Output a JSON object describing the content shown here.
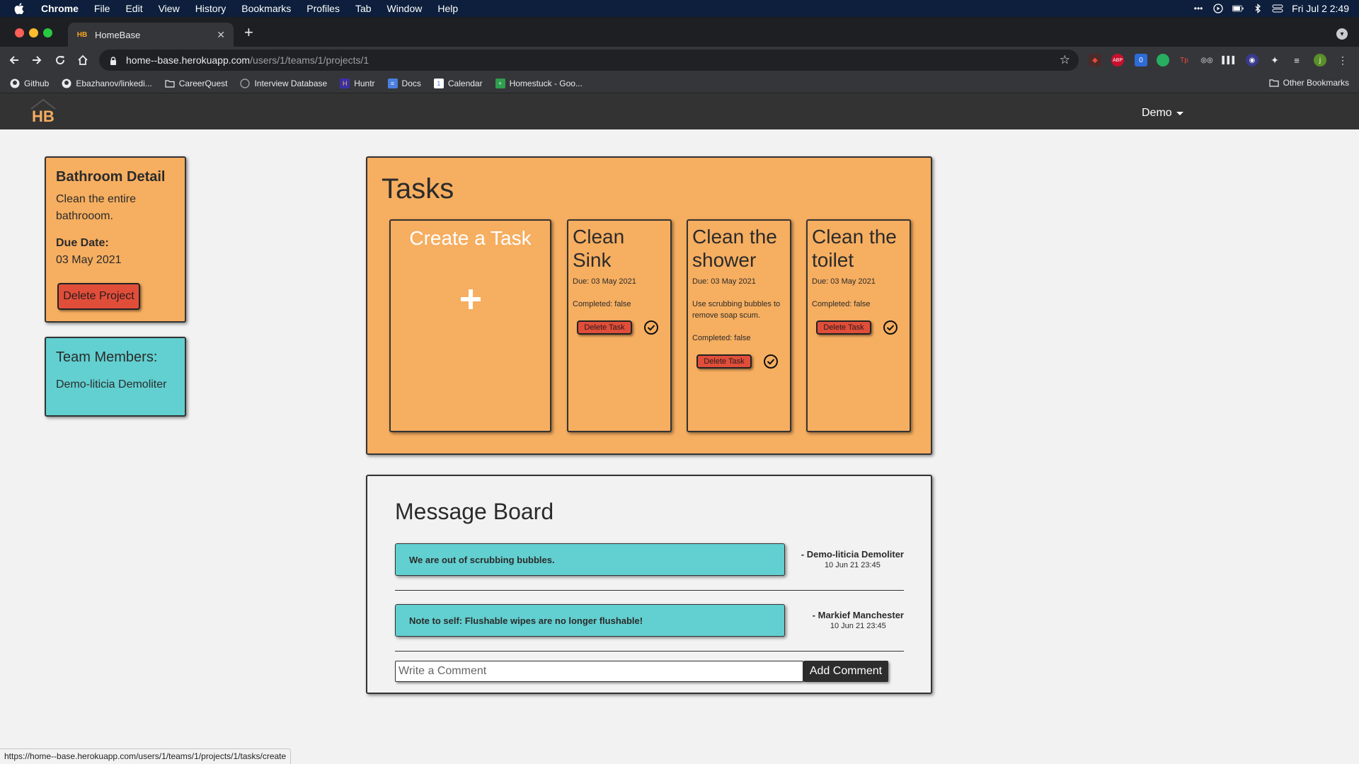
{
  "menubar": {
    "app": "Chrome",
    "items": [
      "File",
      "Edit",
      "View",
      "History",
      "Bookmarks",
      "Profiles",
      "Tab",
      "Window",
      "Help"
    ],
    "clock": "Fri Jul 2  2:49"
  },
  "browser": {
    "tab_title": "HomeBase",
    "url_host": "home--base.herokuapp.com",
    "url_path": "/users/1/teams/1/projects/1",
    "bookmarks": [
      "Github",
      "Ebazhanov/linkedi...",
      "CareerQuest",
      "Interview Database",
      "Huntr",
      "Docs",
      "Calendar",
      "Homestuck - Goo..."
    ],
    "other_bookmarks": "Other Bookmarks",
    "status_url": "https://home--base.herokuapp.com/users/1/teams/1/projects/1/tasks/create"
  },
  "app": {
    "logo_text": "HB",
    "user_menu": "Demo"
  },
  "project": {
    "title": "Bathroom Detail",
    "description": "Clean the entire bathrooom.",
    "due_label": "Due Date:",
    "due_value": "03 May 2021",
    "delete_label": "Delete Project"
  },
  "team": {
    "title": "Team Members:",
    "members": [
      "Demo-liticia Demoliter"
    ]
  },
  "tasks": {
    "heading": "Tasks",
    "create_label": "Create a Task",
    "delete_label": "Delete Task",
    "items": [
      {
        "title": "Clean Sink",
        "due": "Due: 03 May 2021",
        "note": "",
        "completed": "Completed: false"
      },
      {
        "title": "Clean the shower",
        "due": "Due: 03 May 2021",
        "note": "Use scrubbing bubbles to remove soap scum.",
        "completed": "Completed: false"
      },
      {
        "title": "Clean the toilet",
        "due": "Due: 03 May 2021",
        "note": "",
        "completed": "Completed: false"
      }
    ]
  },
  "board": {
    "heading": "Message Board",
    "messages": [
      {
        "text": "We are out of scrubbing bubbles.",
        "author": "- Demo-liticia Demoliter",
        "date": "10 Jun 21 23:45"
      },
      {
        "text": "Note to self: Flushable wipes are no longer flushable!",
        "author": "- Markief Manchester",
        "date": "10 Jun 21 23:45"
      }
    ],
    "input_placeholder": "Write a Comment",
    "add_label": "Add Comment"
  },
  "colors": {
    "orange_card": "#f6ae60",
    "teal_card": "#62cfd0",
    "red_button": "#e04e3a",
    "navbar": "#333333"
  }
}
